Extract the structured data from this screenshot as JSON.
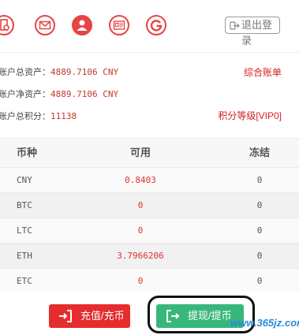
{
  "header": {
    "logout_label": "退出登录",
    "icons": [
      "document-settings-icon",
      "mail-icon",
      "user-icon",
      "id-card-icon",
      "google-icon"
    ]
  },
  "summary": {
    "total_assets_label": "账户总资产：",
    "total_assets_value": "4889.7106 CNY",
    "net_assets_label": "账户净资产：",
    "net_assets_value": "4889.7106 CNY",
    "total_points_label": "账户总积分：",
    "total_points_value": "11138",
    "overview_link": "综合账单",
    "points_level": "积分等级[VIP0]"
  },
  "table": {
    "headers": [
      "币种",
      "可用",
      "冻结"
    ],
    "rows": [
      {
        "currency": "CNY",
        "available": "0.8403",
        "frozen": "0"
      },
      {
        "currency": "BTC",
        "available": "0",
        "frozen": "0"
      },
      {
        "currency": "LTC",
        "available": "0",
        "frozen": "0"
      },
      {
        "currency": "ETH",
        "available": "3.7966206",
        "frozen": "0"
      },
      {
        "currency": "ETC",
        "available": "0",
        "frozen": "0"
      }
    ]
  },
  "actions": {
    "deposit_label": "充值/充币",
    "withdraw_label": "提现/提币"
  },
  "watermark": "www.365jz.com",
  "colors": {
    "accent_red": "#e64545",
    "button_red": "#e62d2d",
    "button_green": "#38b77c",
    "value_red": "#e03030"
  }
}
